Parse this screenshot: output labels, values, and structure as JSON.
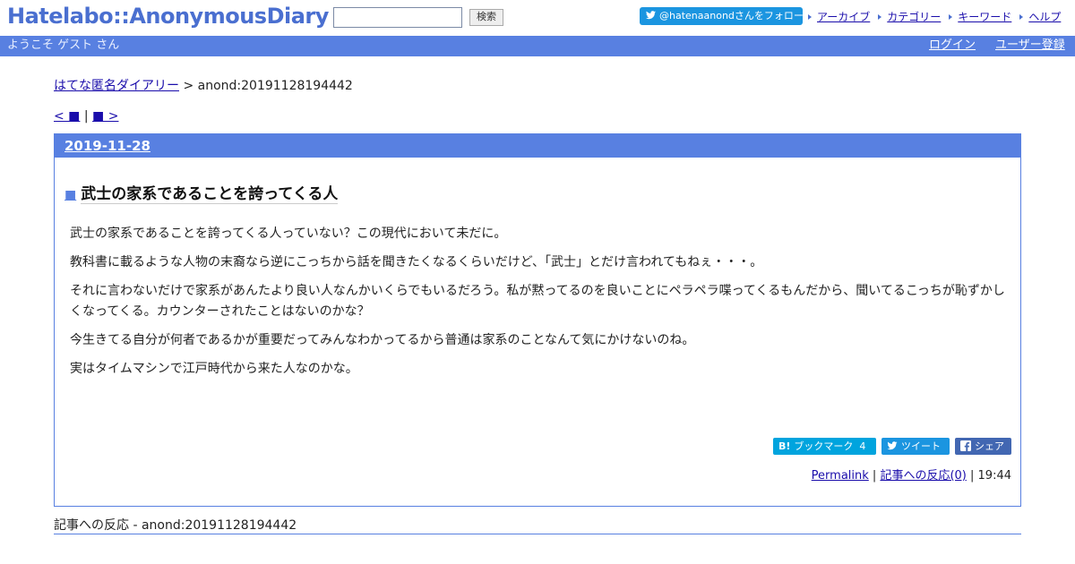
{
  "header": {
    "logo": "Hatelabo::AnonymousDiary",
    "search_placeholder": "",
    "search_button": "検索",
    "twitter_follow": "@hatenaanondさんをフォロー",
    "nav": [
      {
        "label": "アーカイブ"
      },
      {
        "label": "カテゴリー"
      },
      {
        "label": "キーワード"
      },
      {
        "label": "ヘルプ"
      }
    ]
  },
  "welcome_bar": {
    "welcome": "ようこそ ゲスト さん",
    "login": "ログイン",
    "register": "ユーザー登録"
  },
  "breadcrumb": {
    "home": "はてな匿名ダイアリー",
    "separator": " > ",
    "current": "anond:20191128194442"
  },
  "pager": {
    "prev": "< ■",
    "separator": " | ",
    "next": "■ >"
  },
  "day": {
    "date": "2019-11-28",
    "entry": {
      "title_marker": "■",
      "title": "武士の家系であることを誇ってくる人",
      "paragraphs": [
        "武士の家系であることを誇ってくる人っていない？この現代において未だに。",
        "教科書に載るような人物の末裔なら逆にこっちから話を聞きたくなるくらいだけど、「武士」とだけ言われてもねぇ・・・。",
        "それに言わないだけで家系があんたより良い人なんかいくらでもいるだろう。私が黙ってるのを良いことにペラペラ喋ってくるもんだから、聞いてるこっちが恥ずかしくなってくる。カウンターされたことはないのかな？",
        "今生きてる自分が何者であるかが重要だってみんなわかってるから普通は家系のことなんて気にかけないのね。",
        "実はタイムマシンで江戸時代から来た人なのかな。"
      ],
      "share": {
        "hatebu_label": "ブックマーク",
        "hatebu_count": "4",
        "tweet_label": "ツイート",
        "facebook_label": "シェア"
      },
      "permalink": "Permalink",
      "reactions_link": "記事への反応(0)",
      "time": "19:44"
    }
  },
  "reactions_section": {
    "title": "記事への反応 - anond:20191128194442"
  },
  "colors": {
    "accent": "#5880e1",
    "logo": "#4a6fd0",
    "twitter": "#1b95e0",
    "hatebu": "#00a4de",
    "facebook": "#4267b2",
    "link": "#1a0dab"
  }
}
